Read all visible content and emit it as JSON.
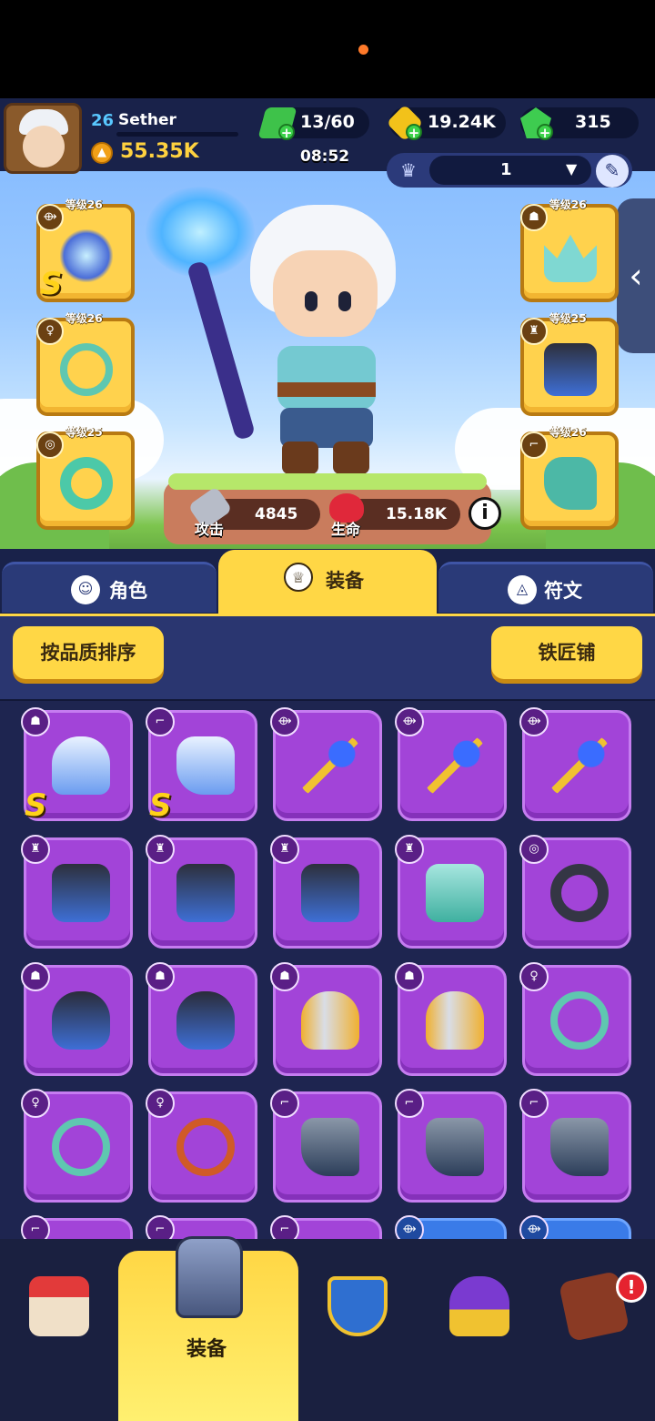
{
  "player": {
    "level": "26",
    "name": "Sether",
    "power": "55.35K"
  },
  "resources": {
    "energy": "13/60",
    "gold": "19.24K",
    "gems": "315"
  },
  "timer": "08:52",
  "preset": {
    "value": "1"
  },
  "equipped_slots": [
    {
      "type_icon": "staff-icon",
      "level": "等级26",
      "grade": "S",
      "item": "ice-staff"
    },
    {
      "type_icon": "necklace-icon",
      "level": "等级26",
      "grade": "",
      "item": "octopus-necklace"
    },
    {
      "type_icon": "ring-icon",
      "level": "等级25",
      "grade": "",
      "item": "jade-ring"
    },
    {
      "type_icon": "helmet-icon",
      "level": "等级26",
      "grade": "",
      "item": "ice-crown"
    },
    {
      "type_icon": "armor-icon",
      "level": "等级25",
      "grade": "",
      "item": "shield-cape"
    },
    {
      "type_icon": "boots-icon",
      "level": "等级26",
      "grade": "",
      "item": "teal-boots"
    }
  ],
  "stats": {
    "attack_label": "攻击",
    "attack_value": "4845",
    "hp_label": "生命",
    "hp_value": "15.18K"
  },
  "tabs": [
    {
      "label": "角色",
      "icon": "character-icon"
    },
    {
      "label": "装备",
      "icon": "equipment-icon"
    },
    {
      "label": "符文",
      "icon": "rune-icon"
    }
  ],
  "buttons": {
    "sort": "按品质排序",
    "blacksmith": "铁匠铺"
  },
  "inventory": [
    {
      "type_icon": "helmet-icon",
      "item": "winged-helmet",
      "grade": "S",
      "color": "#a244d8"
    },
    {
      "type_icon": "boots-icon",
      "item": "winged-boots",
      "grade": "S",
      "color": "#a244d8"
    },
    {
      "type_icon": "staff-icon",
      "item": "sapphire-wand",
      "grade": "",
      "color": "#a244d8"
    },
    {
      "type_icon": "staff-icon",
      "item": "sapphire-wand",
      "grade": "",
      "color": "#a244d8"
    },
    {
      "type_icon": "staff-icon",
      "item": "sapphire-wand",
      "grade": "",
      "color": "#a244d8"
    },
    {
      "type_icon": "armor-icon",
      "item": "shield-cape",
      "grade": "",
      "color": "#a244d8"
    },
    {
      "type_icon": "armor-icon",
      "item": "shield-cape",
      "grade": "",
      "color": "#a244d8"
    },
    {
      "type_icon": "armor-icon",
      "item": "shield-cape",
      "grade": "",
      "color": "#a244d8"
    },
    {
      "type_icon": "armor-icon",
      "item": "jade-armor",
      "grade": "",
      "color": "#a244d8"
    },
    {
      "type_icon": "ring-icon",
      "item": "star-ring",
      "grade": "",
      "color": "#a244d8"
    },
    {
      "type_icon": "helmet-icon",
      "item": "dark-mask",
      "grade": "",
      "color": "#a244d8"
    },
    {
      "type_icon": "helmet-icon",
      "item": "dark-mask",
      "grade": "",
      "color": "#a244d8"
    },
    {
      "type_icon": "helmet-icon",
      "item": "knight-helmet",
      "grade": "",
      "color": "#a244d8"
    },
    {
      "type_icon": "helmet-icon",
      "item": "knight-helmet",
      "grade": "",
      "color": "#a244d8"
    },
    {
      "type_icon": "necklace-icon",
      "item": "octopus-necklace",
      "grade": "",
      "color": "#a244d8"
    },
    {
      "type_icon": "necklace-icon",
      "item": "octopus-necklace",
      "grade": "",
      "color": "#a244d8"
    },
    {
      "type_icon": "necklace-icon",
      "item": "chain-necklace",
      "grade": "",
      "color": "#a244d8"
    },
    {
      "type_icon": "boots-icon",
      "item": "iron-boots",
      "grade": "",
      "color": "#a244d8"
    },
    {
      "type_icon": "boots-icon",
      "item": "iron-boots",
      "grade": "",
      "color": "#a244d8"
    },
    {
      "type_icon": "boots-icon",
      "item": "iron-boots",
      "grade": "",
      "color": "#a244d8"
    },
    {
      "type_icon": "boots-icon",
      "item": "partial-item",
      "grade": "",
      "color": "#a244d8"
    },
    {
      "type_icon": "boots-icon",
      "item": "partial-item",
      "grade": "",
      "color": "#a244d8"
    },
    {
      "type_icon": "boots-icon",
      "item": "partial-item",
      "grade": "",
      "color": "#a244d8"
    },
    {
      "type_icon": "staff-icon",
      "item": "partial-item",
      "grade": "",
      "color": "#3a7be8"
    },
    {
      "type_icon": "staff-icon",
      "item": "partial-item",
      "grade": "",
      "color": "#3a7be8"
    }
  ],
  "bottom_nav": [
    {
      "name": "shop",
      "icon": "shop-icon",
      "label": ""
    },
    {
      "name": "equipment",
      "icon": "armor-icon",
      "label": "装备"
    },
    {
      "name": "battle",
      "icon": "shield-sword-icon",
      "label": ""
    },
    {
      "name": "trophy",
      "icon": "chalice-icon",
      "label": ""
    },
    {
      "name": "event",
      "icon": "hammer-icon",
      "label": "",
      "alert": "!"
    }
  ],
  "colors": {
    "epic_purple": "#a244d8",
    "rare_blue": "#3a7be8",
    "accent_yellow": "#ffd745",
    "power_gold": "#ffd23f"
  }
}
